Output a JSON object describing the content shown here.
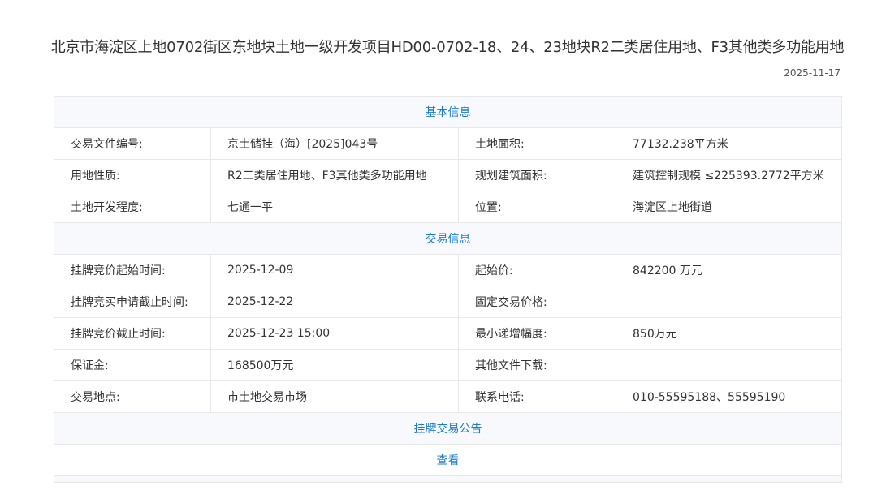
{
  "title": "北京市海淀区上地0702街区东地块土地一级开发项目HD00-0702-18、24、23地块R2二类居住用地、F3其他类多功能用地",
  "date": "2025-11-17",
  "sections": {
    "basic": "基本信息",
    "trade": "交易信息",
    "notice": "挂牌交易公告",
    "view_link": "查看"
  },
  "basic_rows": [
    [
      "交易文件编号:",
      "京土储挂（海）[2025]043号",
      "土地面积:",
      "77132.238平方米"
    ],
    [
      "用地性质:",
      "R2二类居住用地、F3其他类多功能用地",
      "规划建筑面积:",
      "建筑控制规模 ≤225393.2772平方米"
    ],
    [
      "土地开发程度:",
      "七通一平",
      "位置:",
      "海淀区上地街道"
    ]
  ],
  "trade_rows": [
    [
      "挂牌竞价起始时间:",
      "2025-12-09",
      "起始价:",
      "842200 万元"
    ],
    [
      "挂牌竞买申请截止时间:",
      "2025-12-22",
      "固定交易价格:",
      ""
    ],
    [
      "挂牌竞价截止时间:",
      "2025-12-23 15:00",
      "最小递增幅度:",
      "850万元"
    ],
    [
      "保证金:",
      "168500万元",
      "其他文件下载:",
      ""
    ],
    [
      "交易地点:",
      "市土地交易市场",
      "联系电话:",
      "010-55595188、55595190"
    ]
  ]
}
